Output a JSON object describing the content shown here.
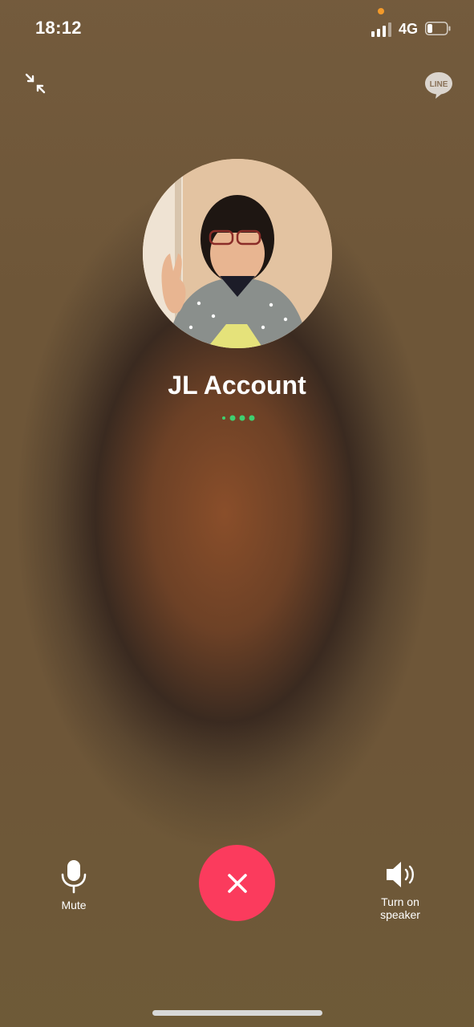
{
  "status_bar": {
    "time": "18:12",
    "network": "4G"
  },
  "top_bar": {
    "line_logo": "LINE"
  },
  "caller": {
    "name": "JL Account"
  },
  "controls": {
    "mute_label": "Mute",
    "speaker_label": "Turn on speaker"
  },
  "colors": {
    "end_call": "#fb3b5d",
    "connecting_dots": "#3fcf6f",
    "privacy_dot": "#f39a2a"
  },
  "icons": {
    "minimize": "minimize-icon",
    "line_logo": "line-logo-icon",
    "mute": "microphone-icon",
    "end_call": "close-icon",
    "speaker": "speaker-icon"
  }
}
